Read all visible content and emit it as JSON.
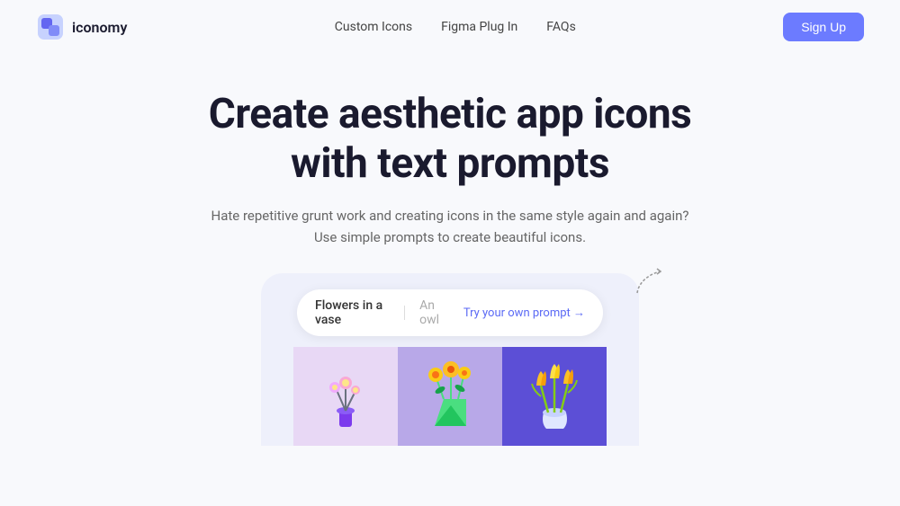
{
  "nav": {
    "logo_text": "iconomy",
    "links": [
      {
        "label": "Custom Icons",
        "id": "custom-icons"
      },
      {
        "label": "Figma Plug In",
        "id": "figma-plugin"
      },
      {
        "label": "FAQs",
        "id": "faqs"
      }
    ],
    "signup_label": "Sign Up"
  },
  "hero": {
    "title_line1": "Create aesthetic app icons",
    "title_line2": "with text prompts",
    "subtitle_line1": "Hate repetitive grunt work and creating icons in the same style again and again?",
    "subtitle_line2": "Use simple prompts to create beautiful icons."
  },
  "demo": {
    "prompt_text": "Flowers in a vase",
    "prompt_placeholder": "An owl",
    "prompt_link": "Try your own prompt →"
  },
  "colors": {
    "accent": "#6c7bff",
    "card1_bg": "#e8d8f5",
    "card2_bg": "#b8a8e8",
    "card3_bg": "#5c4fd6"
  }
}
